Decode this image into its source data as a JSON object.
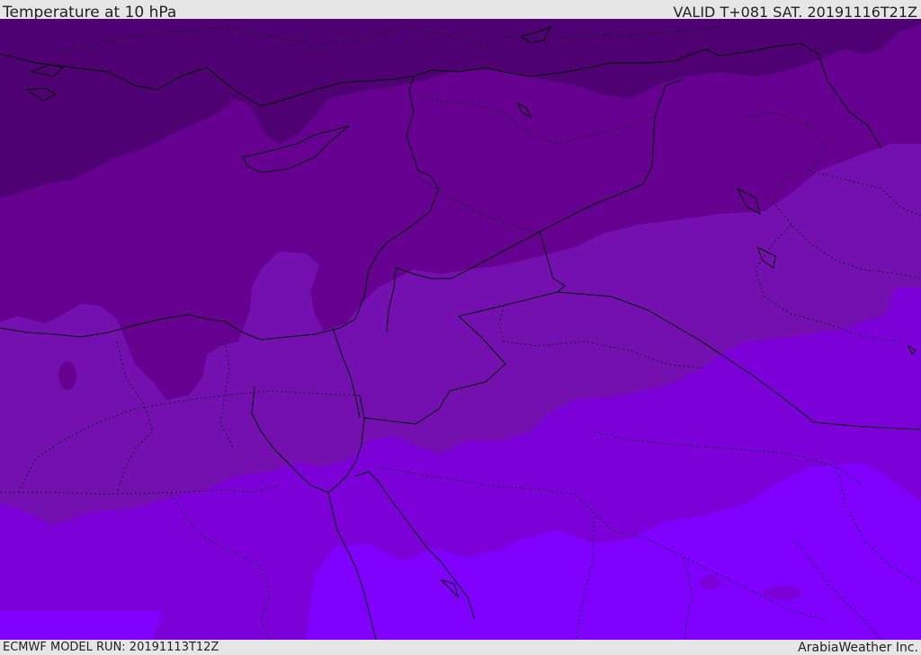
{
  "header": {
    "title": "Temperature at 10 hPa",
    "valid_time": "VALID T+081 SAT. 20191116T21Z"
  },
  "footer": {
    "model_run": "ECMWF MODEL RUN: 20191113T12Z",
    "credit": "ArabiaWeather Inc."
  },
  "map": {
    "field": "temperature",
    "level": "10 hPa",
    "shading_colors": [
      "#4f0072",
      "#650090",
      "#7410b0",
      "#7c00d8",
      "#8000ff"
    ],
    "boundary_color": "#000000"
  }
}
